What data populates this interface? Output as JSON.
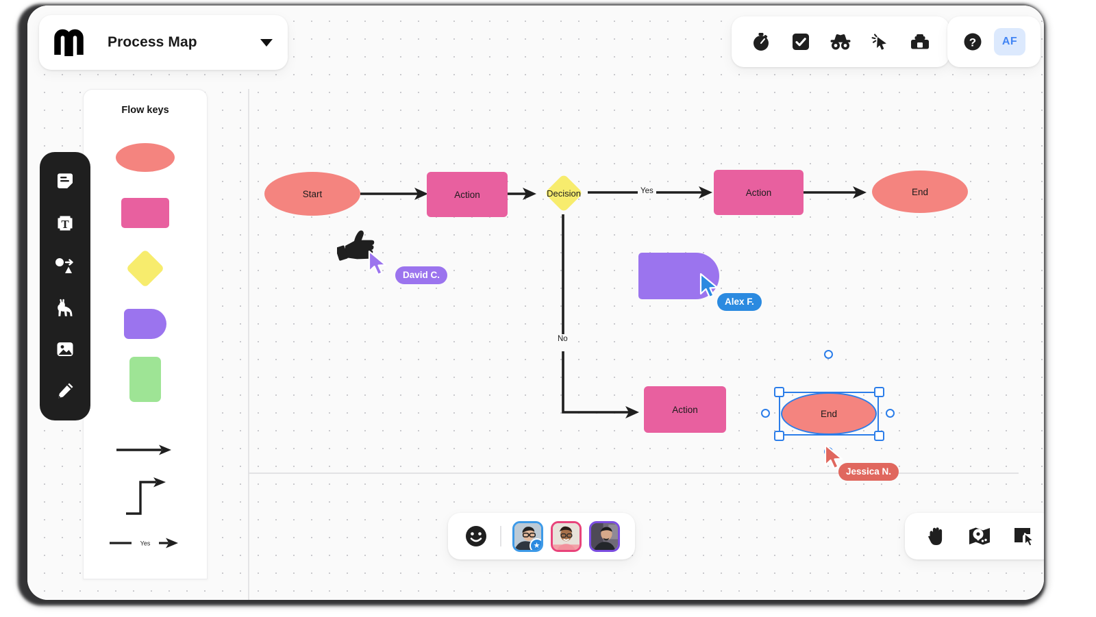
{
  "header": {
    "logo": "miro-logo-icon",
    "title": "Process Map",
    "dropdown": "chevron-down-icon"
  },
  "top_toolbar": {
    "items": [
      {
        "name": "timer-icon",
        "label": "Timer"
      },
      {
        "name": "checkbox-icon",
        "label": "Voting"
      },
      {
        "name": "incognito-glasses-icon",
        "label": "Private mode"
      },
      {
        "name": "cursor-click-icon",
        "label": "Attention"
      },
      {
        "name": "toolbox-icon",
        "label": "Apps"
      }
    ]
  },
  "top_right": {
    "help_icon": "question-mark-icon",
    "avatar_initials": "AF"
  },
  "left_toolbar": {
    "items": [
      {
        "name": "sticky-note-icon",
        "label": "Sticky note"
      },
      {
        "name": "text-icon",
        "label": "Text"
      },
      {
        "name": "shapes-connector-icon",
        "label": "Shapes"
      },
      {
        "name": "llama-icon",
        "label": "Llama"
      },
      {
        "name": "image-icon",
        "label": "Upload"
      },
      {
        "name": "pen-icon",
        "label": "Pen"
      }
    ]
  },
  "flow_keys": {
    "title": "Flow keys",
    "shapes": [
      {
        "name": "ellipse-swatch",
        "kind": "ellipse",
        "color": "#f4847f"
      },
      {
        "name": "rectangle-swatch",
        "kind": "rect",
        "color": "#e8609f"
      },
      {
        "name": "diamond-swatch",
        "kind": "diamond",
        "color": "#f7ec6d"
      },
      {
        "name": "d-shape-swatch",
        "kind": "dshape",
        "color": "#9b74ee"
      },
      {
        "name": "green-rect-swatch",
        "kind": "vrect",
        "color": "#9ee495"
      }
    ],
    "connectors": [
      {
        "name": "straight-arrow-legend",
        "label": ""
      },
      {
        "name": "elbow-arrow-legend",
        "label": ""
      },
      {
        "name": "labeled-arrow-legend",
        "label": "Yes"
      }
    ]
  },
  "canvas": {
    "nodes": [
      {
        "id": "start",
        "label": "Start",
        "shape": "ellipse",
        "color": "#f4847f"
      },
      {
        "id": "action1",
        "label": "Action",
        "shape": "rect",
        "color": "#e8609f"
      },
      {
        "id": "decision",
        "label": "Decision",
        "shape": "diamond",
        "color": "#f7ec6d"
      },
      {
        "id": "action2",
        "label": "Action",
        "shape": "rect",
        "color": "#e8609f"
      },
      {
        "id": "end1",
        "label": "End",
        "shape": "ellipse",
        "color": "#f4847f"
      },
      {
        "id": "dshape",
        "label": "",
        "shape": "dshape",
        "color": "#9b74ee"
      },
      {
        "id": "action3",
        "label": "Action",
        "shape": "rect",
        "color": "#e8609f"
      },
      {
        "id": "end2",
        "label": "End",
        "shape": "ellipse",
        "color": "#f4847f",
        "selected": true
      }
    ],
    "edge_labels": {
      "yes": "Yes",
      "no": "No"
    },
    "selection_color": "#2b7de9"
  },
  "cursors": [
    {
      "name": "David C.",
      "color": "#9b74ee",
      "emoji": "thumbs-up-icon"
    },
    {
      "name": "Alex F.",
      "color": "#2b8ae0",
      "emoji": ""
    },
    {
      "name": "Jessica N.",
      "color": "#e0675e",
      "emoji": ""
    }
  ],
  "bottom_bar": {
    "reaction_icon": "smiley-face-icon",
    "collaborators": [
      {
        "name": "collaborator-avatar-1",
        "border": "#3d9ae8",
        "badge": "star-icon"
      },
      {
        "name": "collaborator-avatar-2",
        "border": "#e8437a",
        "badge": ""
      },
      {
        "name": "collaborator-avatar-3",
        "border": "#7b4de0",
        "badge": ""
      }
    ]
  },
  "bottom_right": {
    "items": [
      {
        "name": "hand-pan-icon",
        "label": "Pan"
      },
      {
        "name": "minimap-icon",
        "label": "Minimap"
      },
      {
        "name": "frame-cursor-icon",
        "label": "Present"
      }
    ]
  }
}
